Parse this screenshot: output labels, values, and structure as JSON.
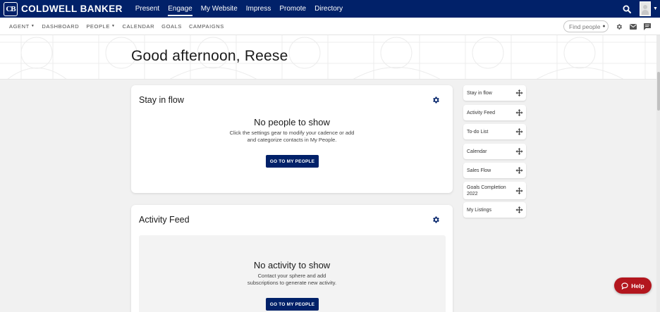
{
  "brand": {
    "mark": "CB",
    "name": "COLDWELL BANKER"
  },
  "top_nav": [
    {
      "label": "Present",
      "active": false
    },
    {
      "label": "Engage",
      "active": true
    },
    {
      "label": "My Website",
      "active": false
    },
    {
      "label": "Impress",
      "active": false
    },
    {
      "label": "Promote",
      "active": false
    },
    {
      "label": "Directory",
      "active": false
    }
  ],
  "sub_nav": [
    {
      "label": "AGENT",
      "dropdown": true
    },
    {
      "label": "DASHBOARD",
      "dropdown": false
    },
    {
      "label": "PEOPLE",
      "dropdown": true
    },
    {
      "label": "CALENDAR",
      "dropdown": false
    },
    {
      "label": "GOALS",
      "dropdown": false
    },
    {
      "label": "CAMPAIGNS",
      "dropdown": false
    }
  ],
  "find_people": {
    "placeholder": "Find people"
  },
  "greeting": "Good afternoon, Reese",
  "stay_in_flow": {
    "title": "Stay in flow",
    "empty_title": "No people to show",
    "empty_line1": "Click the settings gear to modify your cadence or add",
    "empty_line2": "and categorize contacts in My People.",
    "button": "GO TO MY PEOPLE"
  },
  "activity_feed": {
    "title": "Activity Feed",
    "empty_title": "No activity to show",
    "empty_line1": "Contact your sphere and add",
    "empty_line2": "subscriptions to generate new activity.",
    "button": "GO TO MY PEOPLE"
  },
  "widgets": [
    {
      "label": "Stay in flow"
    },
    {
      "label": "Activity Feed"
    },
    {
      "label": "To-do List"
    },
    {
      "label": "Calendar"
    },
    {
      "label": "Sales Flow"
    },
    {
      "label": "Goals Completion 2022"
    },
    {
      "label": "My Listings"
    }
  ],
  "help": {
    "label": "Help"
  },
  "colors": {
    "navy": "#012169",
    "help_red": "#b3161e"
  }
}
